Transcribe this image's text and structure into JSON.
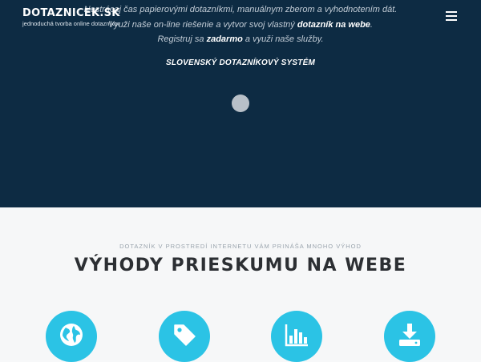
{
  "header": {
    "logo_title": "DOTAZNICEK.SK",
    "logo_tagline": "jednoduchá tvorba online dotazníkov"
  },
  "hero": {
    "line1": "Nestrácaj čas papierovými dotazníkmi, manuálnym zberom a vyhodnotením dát.",
    "line2_before": "Využi naše on-line riešenie a vytvor svoj vlastný ",
    "line2_bold": "dotazník na webe",
    "line2_after": ".",
    "line3_before": "Registruj sa ",
    "line3_bold": "zadarmo",
    "line3_after": " a využi naše služby.",
    "system_label": "SLOVENSKÝ DOTAZNÍKOVÝ SYSTÉM"
  },
  "benefits": {
    "subtitle": "DOTAZNÍK V PROSTREDÍ INTERNETU VÁM PRINÁŠA MNOHO VÝHOD",
    "title": "VÝHODY PRIESKUMU NA WEBE",
    "icons": [
      "globe-icon",
      "tag-icon",
      "bar-chart-icon",
      "download-icon"
    ]
  },
  "colors": {
    "hero_bg": "#0d2b43",
    "accent": "#2bc3e5",
    "section_bg": "#f6f7f8",
    "title_text": "#2c2f33"
  }
}
